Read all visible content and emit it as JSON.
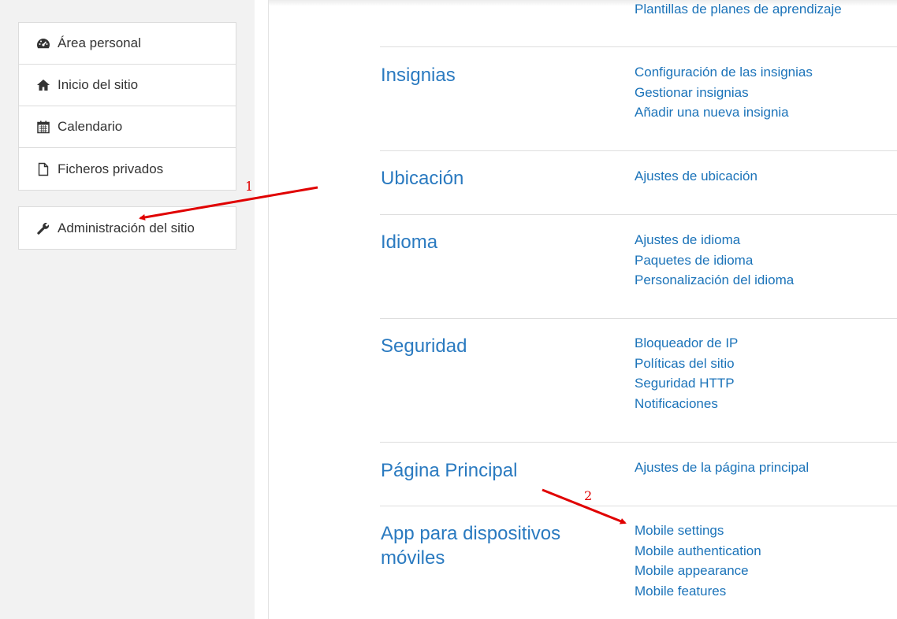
{
  "sidebar": {
    "main_items": [
      {
        "label": "Área personal",
        "icon": "dashboard-icon"
      },
      {
        "label": "Inicio del sitio",
        "icon": "home-icon"
      },
      {
        "label": "Calendario",
        "icon": "calendar-icon"
      },
      {
        "label": "Ficheros privados",
        "icon": "file-icon"
      }
    ],
    "admin_item": {
      "label": "Administración del sitio",
      "icon": "wrench-icon"
    }
  },
  "content": {
    "top_partial_link": "Plantillas de planes de aprendizaje",
    "categories": [
      {
        "title": "Insignias",
        "links": [
          "Configuración de las insignias",
          "Gestionar insignias",
          "Añadir una nueva insignia"
        ]
      },
      {
        "title": "Ubicación",
        "links": [
          "Ajustes de ubicación"
        ]
      },
      {
        "title": "Idioma",
        "links": [
          "Ajustes de idioma",
          "Paquetes de idioma",
          "Personalización del idioma"
        ]
      },
      {
        "title": "Seguridad",
        "links": [
          "Bloqueador de IP",
          "Políticas del sitio",
          "Seguridad HTTP",
          "Notificaciones"
        ]
      },
      {
        "title": "Página Principal",
        "links": [
          "Ajustes de la página principal"
        ]
      },
      {
        "title": "App para dispositivos móviles",
        "links": [
          "Mobile settings",
          "Mobile authentication",
          "Mobile appearance",
          "Mobile features"
        ]
      }
    ]
  },
  "annotations": {
    "step_1_label": "1",
    "step_2_label": "2",
    "color": "#e00000"
  },
  "colors": {
    "link": "#1b73b9",
    "category_title": "#2a7ac0",
    "drawer_bg": "#f2f2f2"
  }
}
